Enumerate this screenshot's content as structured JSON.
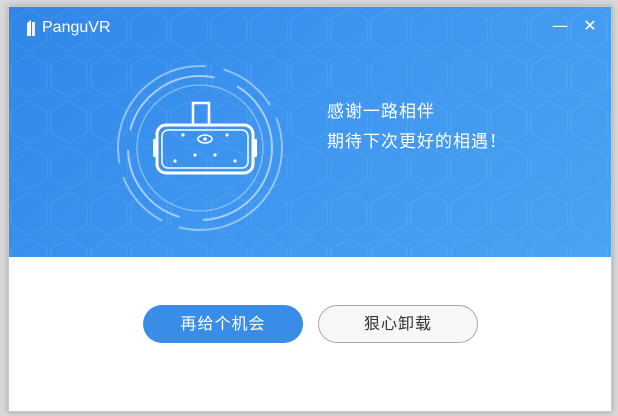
{
  "app": {
    "logo_text": "PanguVR",
    "minimize_symbol": "—",
    "close_symbol": "✕"
  },
  "message": {
    "line1": "感谢一路相伴",
    "line2": "期待下次更好的相遇！"
  },
  "buttons": {
    "retry_label": "再给个机会",
    "uninstall_label": "狠心卸载"
  },
  "icons": {
    "logo": "pangu-logo-icon",
    "illustration": "vr-headset-icon"
  },
  "colors": {
    "banner": "#3d95ef",
    "primary_button": "#3a8de6",
    "secondary_border": "#a8a8a8"
  }
}
